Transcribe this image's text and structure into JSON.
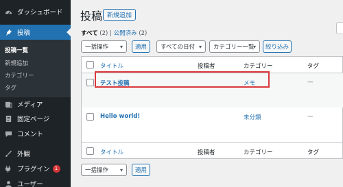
{
  "sidebar": {
    "items": [
      {
        "label": "ダッシュボード",
        "icon": "dashboard-icon"
      },
      {
        "label": "投稿",
        "icon": "pushpin-icon"
      },
      {
        "label": "メディア",
        "icon": "media-icon"
      },
      {
        "label": "固定ページ",
        "icon": "page-icon"
      },
      {
        "label": "コメント",
        "icon": "comment-icon"
      },
      {
        "label": "外観",
        "icon": "brush-icon"
      },
      {
        "label": "プラグイン",
        "icon": "plugin-icon",
        "badge": "1"
      },
      {
        "label": "ユーザー",
        "icon": "user-icon"
      }
    ],
    "submenu": [
      "投稿一覧",
      "新規追加",
      "カテゴリー",
      "タグ"
    ]
  },
  "header": {
    "title": "投稿",
    "add_new": "新規追加"
  },
  "filters": {
    "all_label": "すべて",
    "all_count": "(2)",
    "separator": "|",
    "published_label": "公開済み",
    "published_count": "(2)"
  },
  "top_actions": {
    "bulk_select": "一括操作",
    "apply": "適用",
    "dates_select": "すべての日付",
    "category_select": "カテゴリー一覧",
    "filter_button": "絞り込み"
  },
  "table": {
    "columns": [
      "タイトル",
      "投稿者",
      "カテゴリー",
      "タグ"
    ],
    "rows": [
      {
        "title": "テスト投稿",
        "category": "メモ",
        "tags": "—"
      },
      {
        "title": "Hello world!",
        "category": "未分類",
        "tags": "—"
      }
    ]
  },
  "bottom_actions": {
    "bulk_select": "一括操作",
    "apply": "適用"
  },
  "colors": {
    "sidebar_bg": "#1d2327",
    "accent": "#2271b1",
    "highlight": "#d9383b"
  }
}
